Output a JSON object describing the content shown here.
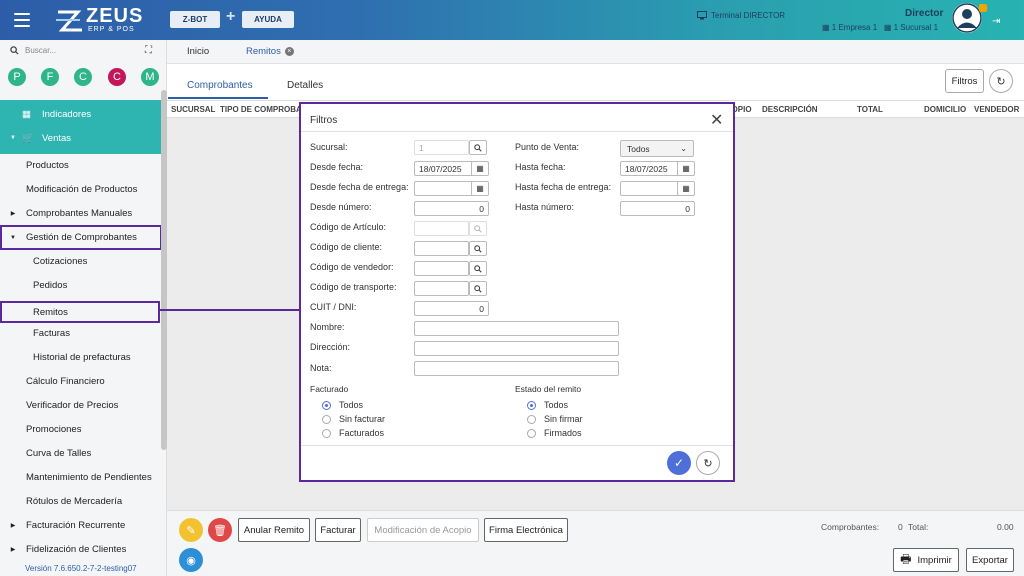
{
  "header": {
    "logo_text": "ZEUS",
    "logo_sub": "ERP & POS",
    "zbot_label": "Z-BOT",
    "plus_label": "+",
    "ayuda_label": "AYUDA",
    "terminal": "Terminal DIRECTOR",
    "user": "Director",
    "empresa": "1 Empresa 1",
    "sucursal": "1 Sucursal 1",
    "colors": {
      "gradient_start": "#2d5da8",
      "gradient_end": "#27b3b1"
    }
  },
  "sidebar": {
    "search_placeholder": "Buscar...",
    "quick_buttons": [
      {
        "letter": "P",
        "color": "#2eb58a"
      },
      {
        "letter": "F",
        "color": "#2eb58a"
      },
      {
        "letter": "C",
        "color": "#2eb58a"
      },
      {
        "letter": "C",
        "color": "#c2185b"
      },
      {
        "letter": "M",
        "color": "#2eb58a"
      }
    ],
    "items": [
      {
        "label": "Indicadores"
      },
      {
        "label": "Ventas"
      },
      {
        "label": "Productos"
      },
      {
        "label": "Modificación de Productos"
      },
      {
        "label": "Comprobantes Manuales"
      },
      {
        "label": "Gestión de Comprobantes"
      },
      {
        "label": "Cotizaciones"
      },
      {
        "label": "Pedidos"
      },
      {
        "label": "Remitos"
      },
      {
        "label": "Facturas"
      },
      {
        "label": "Historial de prefacturas"
      },
      {
        "label": "Cálculo Financiero"
      },
      {
        "label": "Verificador de Precios"
      },
      {
        "label": "Promociones"
      },
      {
        "label": "Curva de Talles"
      },
      {
        "label": "Mantenimiento de Pendientes"
      },
      {
        "label": "Rótulos de Mercadería"
      },
      {
        "label": "Facturación Recurrente"
      },
      {
        "label": "Fidelización de Clientes"
      }
    ],
    "version": "Versión 7.6.650.2-7-2-testing07"
  },
  "tabs": {
    "inicio": "Inicio",
    "remitos": "Remitos"
  },
  "subtabs": {
    "comprobantes": "Comprobantes",
    "detalles": "Detalles"
  },
  "toolbar": {
    "filtros": "Filtros"
  },
  "table": {
    "columns": [
      "SUCURSAL",
      "TIPO DE COMPROBA",
      "DPIO",
      "DESCRIPCIÓN",
      "TOTAL",
      "DOMICILIO",
      "VENDEDOR"
    ]
  },
  "bottom": {
    "anular": "Anular Remito",
    "facturar": "Facturar",
    "acopio": "Modificación de Acopio",
    "firma": "Firma Electrónica",
    "comprobantes_label": "Comprobantes:",
    "comprobantes_value": "0",
    "total_label": "Total:",
    "total_value": "0.00",
    "imprimir": "Imprimir",
    "exportar": "Exportar"
  },
  "modal": {
    "title": "Filtros",
    "sucursal_label": "Sucursal:",
    "sucursal_value": "1",
    "punto_venta_label": "Punto de Venta:",
    "punto_venta_value": "Todos",
    "desde_fecha_label": "Desde fecha:",
    "desde_fecha_value": "18/07/2025",
    "hasta_fecha_label": "Hasta fecha:",
    "hasta_fecha_value": "18/07/2025",
    "desde_fecha_entrega_label": "Desde fecha de entrega:",
    "hasta_fecha_entrega_label": "Hasta fecha de entrega:",
    "desde_numero_label": "Desde número:",
    "desde_numero_value": "0",
    "hasta_numero_label": "Hasta número:",
    "hasta_numero_value": "0",
    "codigo_articulo_label": "Código de Artículo:",
    "codigo_cliente_label": "Código de cliente:",
    "codigo_vendedor_label": "Código de vendedor:",
    "codigo_transporte_label": "Código de transporte:",
    "cuit_label": "CUIT / DNI:",
    "cuit_value": "0",
    "nombre_label": "Nombre:",
    "direccion_label": "Dirección:",
    "nota_label": "Nota:",
    "facturado_label": "Facturado",
    "facturado_options": [
      "Todos",
      "Sin facturar",
      "Facturados"
    ],
    "estado_label": "Estado del remito",
    "estado_options": [
      "Todos",
      "Sin firmar",
      "Firmados"
    ]
  }
}
